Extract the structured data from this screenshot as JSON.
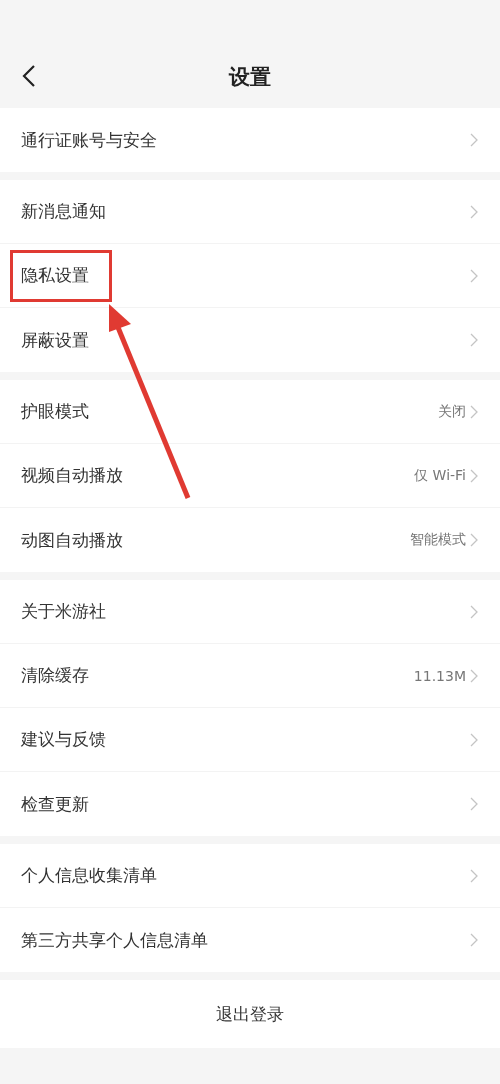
{
  "header": {
    "title": "设置"
  },
  "groups": [
    {
      "items": [
        {
          "label": "通行证账号与安全"
        }
      ]
    },
    {
      "items": [
        {
          "label": "新消息通知"
        },
        {
          "label": "隐私设置",
          "highlighted": true
        },
        {
          "label": "屏蔽设置"
        }
      ]
    },
    {
      "items": [
        {
          "label": "护眼模式",
          "value": "关闭"
        },
        {
          "label": "视频自动播放",
          "value": "仅 Wi-Fi"
        },
        {
          "label": "动图自动播放",
          "value": "智能模式"
        }
      ]
    },
    {
      "items": [
        {
          "label": "关于米游社"
        },
        {
          "label": "清除缓存",
          "value": "11.13M"
        },
        {
          "label": "建议与反馈"
        },
        {
          "label": "检查更新"
        }
      ]
    },
    {
      "items": [
        {
          "label": "个人信息收集清单"
        },
        {
          "label": "第三方共享个人信息清单"
        }
      ]
    }
  ],
  "logout": {
    "label": "退出登录"
  }
}
